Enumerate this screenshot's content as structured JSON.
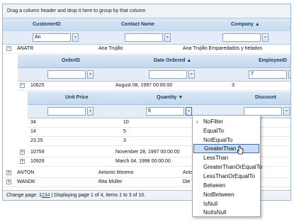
{
  "group_panel_text": "Drag a column header and drop it here to group by that column",
  "master": {
    "headers": [
      "CustomerID",
      "Contact Name",
      "Company"
    ],
    "filter_values": [
      "An",
      "",
      ""
    ],
    "rows": [
      {
        "id": "ANATR",
        "contact": "Ana Trujillo",
        "company": "Ana Trujillo Emparedados y helados"
      },
      {
        "id": "ANTON",
        "contact": "Antonio Moreno",
        "company": "Antonio Moreno Taquería"
      },
      {
        "id": "WANDK",
        "contact": "Rita Müller",
        "company": "Die Wandernde Kuh"
      }
    ]
  },
  "orders": {
    "headers": [
      "OrderID",
      "Date Ordered",
      "EmployeeID"
    ],
    "filter_values": [
      "",
      "",
      "7"
    ],
    "rows": [
      {
        "id": "10625",
        "date": "August 08, 1997 00:00:00",
        "emp": "3"
      },
      {
        "id": "10759",
        "date": "November 28, 1997 00:00:00",
        "emp": ""
      },
      {
        "id": "10926",
        "date": "March 04, 1998 00:00:00",
        "emp": ""
      }
    ]
  },
  "details": {
    "headers": [
      "Unit Price",
      "Quantity",
      "Discount"
    ],
    "filter_values": [
      "",
      "5",
      ""
    ],
    "rows": [
      {
        "price": "34",
        "qty": "10"
      },
      {
        "price": "14",
        "qty": "5"
      },
      {
        "price": "23.25",
        "qty": "3"
      }
    ]
  },
  "pager": {
    "prefix": "Change page:",
    "pages": [
      "1",
      "2",
      "3",
      "4"
    ],
    "summary": "| Displaying page 1 of 4, items 1 to 3 of 10."
  },
  "filter_menu": {
    "items": [
      "NoFilter",
      "EqualTo",
      "NotEqualTo",
      "GreaterThan",
      "LessThan",
      "GreaterThanOrEqualTo",
      "LessThanOrEqualTo",
      "Between",
      "NotBetween",
      "IsNull",
      "NotIsNull"
    ],
    "selected": "GreaterThan"
  },
  "colors": {
    "header_text": "#1c3f63",
    "menu_highlight": "#c9ddf3",
    "border": "#9fb4c9"
  }
}
